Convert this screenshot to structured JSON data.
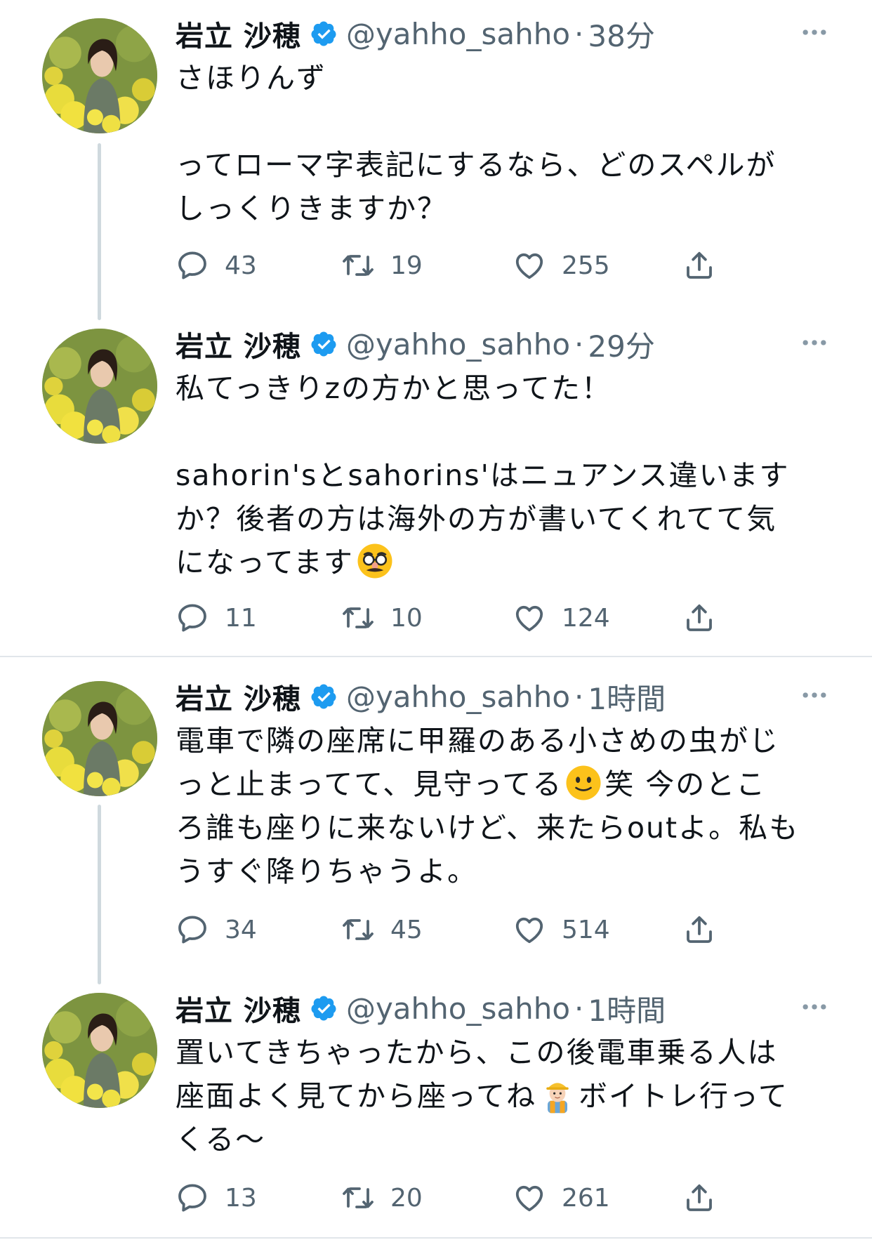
{
  "tweets": [
    {
      "name": "岩立 沙穂",
      "handle": "@yahho_sahho",
      "separator": "·",
      "time": "38分",
      "text_1": "さほりんず\n\nってローマ字表記にするなら、どのスペルが\nしっくりきますか？",
      "replies": "43",
      "retweets": "19",
      "likes": "255"
    },
    {
      "name": "岩立 沙穂",
      "handle": "@yahho_sahho",
      "separator": "·",
      "time": "29分",
      "text_1": "私てっきりzの方かと思ってた！\n\nsahorin'sとsahorins'はニュアンス違います\nか？後者の方は海外の方が書いてくれてて気\nになってます",
      "emoji_1": "disguised-face-emoji",
      "replies": "11",
      "retweets": "10",
      "likes": "124"
    },
    {
      "name": "岩立 沙穂",
      "handle": "@yahho_sahho",
      "separator": "·",
      "time": "1時間",
      "text_1": "電車で隣の座席に甲羅のある小さめの虫がじ\nっと止まってて、見守ってる",
      "emoji_1": "slightly-smiling-face-emoji",
      "text_2": "笑 今のとこ\nろ誰も座りに来ないけど、来たらoutよ。私も\nうすぐ降りちゃうよ。",
      "replies": "34",
      "retweets": "45",
      "likes": "514"
    },
    {
      "name": "岩立 沙穂",
      "handle": "@yahho_sahho",
      "separator": "·",
      "time": "1時間",
      "text_1": "置いてきちゃったから、この後電車乗る人は\n座面よく見てから座ってね",
      "emoji_1": "construction-worker-emoji",
      "text_2": "ボイトレ行って\nくる〜",
      "replies": "13",
      "retweets": "20",
      "likes": "261"
    }
  ],
  "colors": {
    "text": "#0f1419",
    "secondary": "#536471",
    "verified": "#1d9bf0",
    "thread_line": "#cfd9de",
    "divider": "#e1e6ea"
  },
  "icons": [
    "reply-icon",
    "retweet-icon",
    "like-icon",
    "share-icon",
    "more-icon",
    "verified-badge-icon"
  ]
}
